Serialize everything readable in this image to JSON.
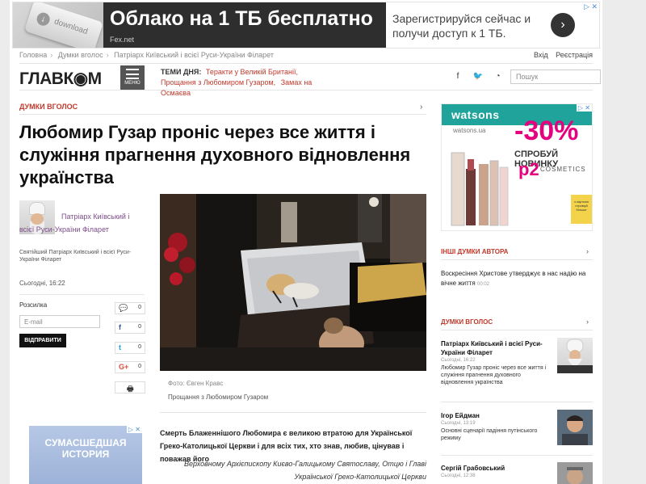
{
  "ad_top": {
    "headline": "Облако на 1 ТБ бесплатно",
    "source": "Fex.net",
    "body": "Зарегистрируйся сейчас и получи доступ к 1 ТБ.",
    "key_label": "download",
    "ad_marks": "▷ ✕"
  },
  "breadcrumb": [
    "Головна",
    "Думки вголос",
    "Патріарх Київський і всієї Руси-України Філарет"
  ],
  "auth": {
    "login": "Вхід",
    "register": "Реєстрація"
  },
  "header": {
    "logo": "ГЛАВК◉М",
    "menu_label": "МЕНЮ",
    "topics_label": "ТЕМИ ДНЯ:",
    "topics": [
      "Теракти у Великій Британії,",
      "Прощання з Любомиром Гузаром,",
      "Замах на Осмаєва"
    ],
    "social": [
      "f",
      "t",
      "rss"
    ],
    "search_placeholder": "Пошук"
  },
  "article": {
    "section": "ДУМКИ ВГОЛОС",
    "title": "Любомир Гузар проніс через все життя і служіння прагнення духовного відновлення українства",
    "author_name": "Патріарх Київський і всієї Руси-України Філарет",
    "author_desc": "Святійший Патріарх Київський і всієї Руси-України Філарет",
    "date": "Сьогодні, 16:22",
    "subscribe_label": "Розсилка",
    "email_placeholder": "E-mail",
    "send_label": "ВІДПРАВИТИ",
    "shares": [
      {
        "icon": "comment-icon",
        "glyph": "💬",
        "count": "0"
      },
      {
        "icon": "facebook-icon",
        "glyph": "f",
        "count": "0"
      },
      {
        "icon": "twitter-icon",
        "glyph": "t",
        "count": "0"
      },
      {
        "icon": "google-plus-icon",
        "glyph": "G+",
        "count": "0"
      },
      {
        "icon": "print-icon",
        "glyph": "🖶",
        "count": ""
      }
    ],
    "photo_credit": "Фото: Євген Кравс",
    "photo_caption": "Прощання з Любомиром Гузаром",
    "lead": "Смерть Блаженнішого Любомира є великою втратою для Української Греко-Католицької Церкви і для всіх тих, хто знав, любив, цінував і поважав його",
    "quote": "Верховному Архієпископу Києво-Галицькому Святославу, Отцю і Главі Української Греко-Католицької Церкви"
  },
  "left_ad": {
    "text": "СУМАСШЕДШАЯ ИСТОРИЯ",
    "ad_marks": "▷ ✕"
  },
  "right_ad": {
    "brand": "watsons",
    "url": "watsons.ua",
    "discount": "-30%",
    "try_text": "СПРОБУЙ НОВИНКУ",
    "product_brand": "p2",
    "product_line": "COSMETICS",
    "badge": "з карткою отримуй більше",
    "ad_marks": "▷ ✕"
  },
  "other_author": {
    "section": "ІНШІ ДУМКИ АВТОРА",
    "item": "Воскресіння Христове утверджує в нас надію на вічне життя",
    "time": "00:02"
  },
  "opinions": {
    "section": "ДУМКИ ВГОЛОС",
    "items": [
      {
        "name": "Патріарх Київський і всієї Руси-України Філарет",
        "date": "Сьогодні, 16:22",
        "text": "Любомир Гузар проніс через все життя і служіння прагнення духовного відновлення українства"
      },
      {
        "name": "Ігор Ейдман",
        "date": "Сьогодні, 13:19",
        "text": "Основні сценарії падіння путінського режиму"
      },
      {
        "name": "Сергій Грабовський",
        "date": "Сьогодні, 12:38",
        "text": ""
      }
    ]
  }
}
